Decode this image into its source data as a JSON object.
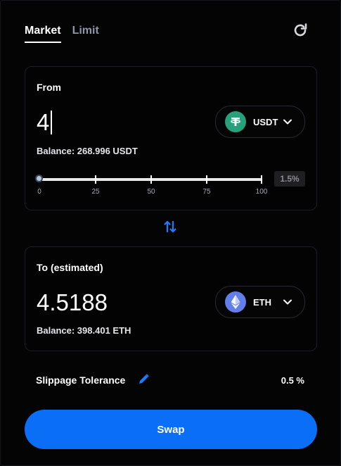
{
  "tabs": [
    {
      "label": "Market",
      "active": true
    },
    {
      "label": "Limit",
      "active": false
    }
  ],
  "from": {
    "label": "From",
    "amount": "4",
    "balance": "Balance: 268.996 USDT",
    "token": {
      "symbol": "USDT",
      "icon": "tether-icon",
      "color": "#26a17b"
    },
    "slider": {
      "ticks": [
        "0",
        "25",
        "50",
        "75",
        "100"
      ],
      "value_percent": 0,
      "percent_display": "1.5%"
    }
  },
  "to": {
    "label": "To (estimated)",
    "amount": "4.5188",
    "balance": "Balance: 398.401 ETH",
    "token": {
      "symbol": "ETH",
      "icon": "ethereum-icon",
      "color": "#627eea"
    }
  },
  "slippage": {
    "label": "Slippage Tolerance",
    "value": "0.5 %"
  },
  "swap_button": "Swap",
  "colors": {
    "accent": "#0b6ef7",
    "background": "#050505",
    "muted_text": "#8f95a8"
  }
}
